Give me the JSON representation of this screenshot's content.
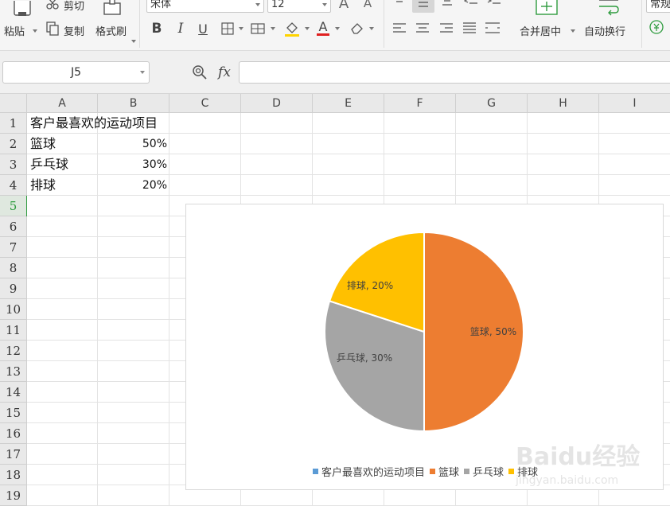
{
  "ribbon": {
    "paste_label": "粘贴",
    "cut_label": "剪切",
    "copy_label": "复制",
    "format_painter_label": "格式刷",
    "font_name": "宋体",
    "font_size": "12",
    "merge_center_label": "合并居中",
    "wrap_text_label": "自动换行",
    "number_format": "常规"
  },
  "formula_bar": {
    "name_box": "J5",
    "fx_label": "fx",
    "formula": ""
  },
  "sheet": {
    "columns": [
      "A",
      "B",
      "C",
      "D",
      "E",
      "F",
      "G",
      "H",
      "I"
    ],
    "rows": [
      "1",
      "2",
      "3",
      "4",
      "5",
      "6",
      "7",
      "8",
      "9",
      "10",
      "11",
      "12",
      "13",
      "14",
      "15",
      "16",
      "17",
      "18",
      "19"
    ],
    "cells": {
      "A1": "客户最喜欢的运动项目",
      "A2": "篮球",
      "B2": "50%",
      "A3": "乒乓球",
      "B3": "30%",
      "A4": "排球",
      "B4": "20%"
    }
  },
  "chart_data": {
    "type": "pie",
    "categories": [
      "篮球",
      "乒乓球",
      "排球"
    ],
    "values": [
      50,
      30,
      20
    ],
    "colors": [
      "#ed7d31",
      "#a5a5a5",
      "#ffc000"
    ],
    "data_labels": [
      "篮球, 50%",
      "乒乓球, 30%",
      "排球, 20%"
    ],
    "legend": {
      "placement": "bottom",
      "entries": [
        {
          "label": "客户最喜欢的运动项目",
          "color": "#5b9bd5"
        },
        {
          "label": "篮球",
          "color": "#ed7d31"
        },
        {
          "label": "乒乓球",
          "color": "#a5a5a5"
        },
        {
          "label": "排球",
          "color": "#ffc000"
        }
      ]
    }
  },
  "watermark": {
    "brand": "Baidu经验",
    "url": "jingyan.baidu.com"
  },
  "colors": {
    "active_green": "#2e9b3e",
    "font_color_red": "#e02020",
    "highlight_yellow": "#ffd400"
  }
}
